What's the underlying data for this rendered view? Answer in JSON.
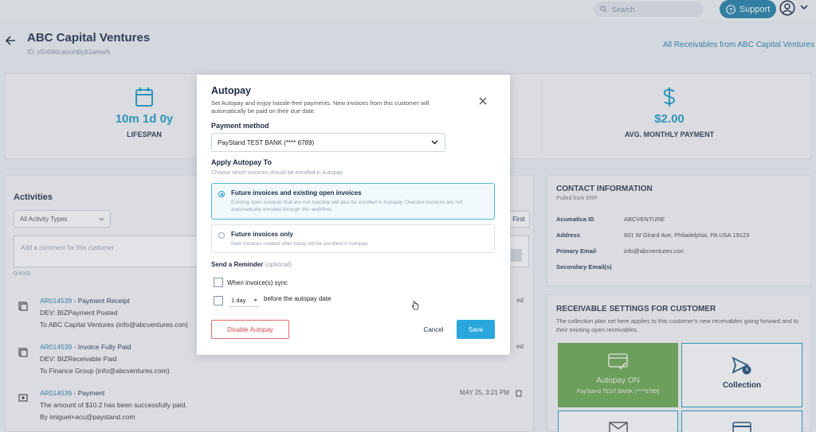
{
  "topbar": {
    "search_placeholder": "Search",
    "support_label": "Support"
  },
  "header": {
    "customer_name": "ABC Capital Ventures",
    "customer_id": "ID: o5n086caivoh6iyb1amwfs",
    "all_receivables_link": "All Receivables from ABC Capital Ventures"
  },
  "stats": [
    {
      "value": "10m 1d 0y",
      "label": "LIFESPAN",
      "icon": "calendar-icon"
    },
    {
      "value": "$2.00",
      "label": "AVG. MONTHLY PAYMENT",
      "icon": "dollar-icon"
    }
  ],
  "activities": {
    "title": "Activities",
    "filter": "All Activity Types",
    "first_btn": "First",
    "comment_placeholder": "Add a comment for this customer",
    "char_count": "0/4000",
    "items": [
      {
        "ref": "AR014539",
        "title": " - Payment Receipt",
        "line2": "DEV: BIZPayment Posted",
        "line3": "To ABC Capital Ventures (info@abcventures.con)",
        "date": "ed"
      },
      {
        "ref": "AR014539",
        "title": " - Invoice Fully Paid",
        "line2": "DEV: BIZReceivable Paid",
        "line3": "To Finance Group (info@abcventures.com)",
        "date": "ed"
      },
      {
        "ref": "AR014539",
        "title": " - Payment",
        "line2": "The amount of $10.2 has been successfully paid.",
        "line3": "By imiguel+acu@paystand.com",
        "date": "MAY 25, 3:21 PM"
      }
    ]
  },
  "contact": {
    "title": "CONTACT INFORMATION",
    "subtitle": "Pulled from ERP",
    "rows": [
      {
        "key": "Acumatica ID",
        "value": "ABCVENTURE"
      },
      {
        "key": "Address",
        "value": "601 W Girard Ave, Philadelphia, PA USA 19123"
      },
      {
        "key": "Primary Email",
        "value": "info@abcventures.con"
      },
      {
        "key": "Secondary Email(s)",
        "value": ""
      }
    ]
  },
  "receivable_settings": {
    "title": "RECEIVABLE SETTINGS FOR CUSTOMER",
    "subtitle": "The collection plan set here applies to this customer's new receivables going forward and to their existing open receivables.",
    "autopay_tile": {
      "title": "Autopay ON",
      "sub": "PayStand TEST BANK (****6789)"
    },
    "collection_tile": {
      "title": "Collection"
    }
  },
  "modal": {
    "title": "Autopay",
    "subtitle": "Set Autopay and enjoy hassle-free payments. New invoices from this customer will automatically be paid on their due date.",
    "payment_method_label": "Payment method",
    "payment_method_value": "PayStand TEST BANK (**** 6789)",
    "apply_label": "Apply Autopay To",
    "apply_hint": "Choose which invoices should be enrolled in Autopay.",
    "options": [
      {
        "title": "Future invoices and existing open invoices",
        "desc": "Existing open invoices that are not overdue will also be enrolled in Autopay. Overdue invoices are not automatically enrolled through this workflow.",
        "selected": true
      },
      {
        "title": "Future invoices only",
        "desc": "New invoices created after today will be enrolled in Autopay.",
        "selected": false
      }
    ],
    "reminder_label": "Send a Reminder",
    "reminder_optional": "(optional)",
    "when_sync_label": "When invoice(s) sync",
    "day_value": "1 day",
    "before_label": "before the autopay date",
    "disable_btn": "Disable Autopay",
    "cancel_btn": "Cancel",
    "save_btn": "Save"
  }
}
